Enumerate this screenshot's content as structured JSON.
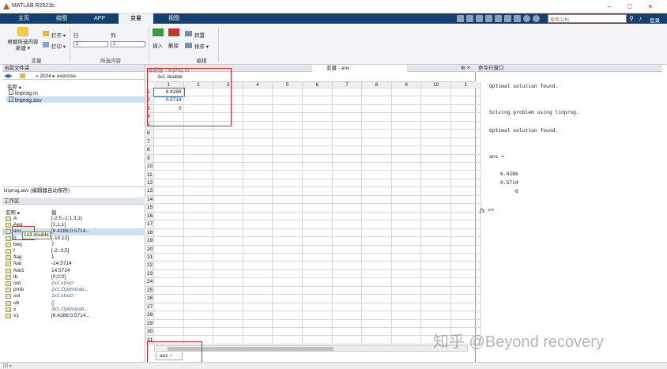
{
  "window": {
    "title": "MATLAB R2021b",
    "controls": [
      "–",
      "□",
      "×"
    ]
  },
  "tabs": [
    {
      "label": "主页"
    },
    {
      "label": "绘图"
    },
    {
      "label": "APP"
    },
    {
      "label": "变量",
      "active": true
    },
    {
      "label": "视图"
    }
  ],
  "search": {
    "placeholder": "搜索文档"
  },
  "login": "登录",
  "ribbon": {
    "new_from_selection": "根据所选内容\n新建 ▾",
    "open": "打开 ▾",
    "print": "打印 ▾",
    "row_label": "行",
    "col_label": "列",
    "row_value": "1",
    "col_value": "1",
    "insert": "插入",
    "delete": "删除",
    "transpose": "转置",
    "sort": "排序 ▾",
    "group_variable": "变量",
    "group_selection": "所选内容",
    "group_edit": "编辑"
  },
  "current_folder": {
    "header": "当前文件夹",
    "path": "« 2024 ▸ exercise",
    "name_col": "名称 ▴",
    "files": [
      {
        "name": "linprog.m"
      },
      {
        "name": "linprog.asv",
        "selected": true
      }
    ],
    "details": "linprog.asv (编辑器自动保存)"
  },
  "workspace": {
    "header": "工作区",
    "col_name": "名称 ▴",
    "col_value": "值",
    "rows": [
      {
        "name": "A",
        "value": "[-2,5,-1;1,3,1]"
      },
      {
        "name": "Aeq",
        "value": "[1,1,1]"
      },
      {
        "name": "ans",
        "value": "[6.4286;0.5714..."
      },
      {
        "name": "b",
        "value": "[-10;12]"
      },
      {
        "name": "beq",
        "value": "7"
      },
      {
        "name": "f",
        "value": "[-2;-3;5]"
      },
      {
        "name": "flag",
        "value": "1"
      },
      {
        "name": "fval",
        "value": "-14.5714"
      },
      {
        "name": "fval1",
        "value": "14.5714"
      },
      {
        "name": "lb",
        "value": "[0;0;0]"
      },
      {
        "name": "out",
        "value": "1x1 struct",
        "italic": true
      },
      {
        "name": "prob",
        "value": "1x1 Optimizati...",
        "italic": true
      },
      {
        "name": "sol",
        "value": "1x1 struct",
        "italic": true
      },
      {
        "name": "ub",
        "value": "[]",
        "italic": true
      },
      {
        "name": "x",
        "value": "3x1 Optimizati...",
        "italic": true
      },
      {
        "name": "x1",
        "value": "[6.4286;0.5714..."
      }
    ],
    "tooltip": "1x3 double"
  },
  "variables": {
    "tab_editor": "编辑器 - linprog.m",
    "tab_vars": "变量 - ans",
    "var_size": "3x1 double",
    "columns": [
      "1",
      "2",
      "3",
      "4",
      "5",
      "6",
      "7",
      "8",
      "9",
      "10",
      "1"
    ],
    "rows": [
      "1",
      "2",
      "3",
      "4",
      "5",
      "6",
      "7",
      "8",
      "9",
      "10",
      "11",
      "12",
      "13",
      "14",
      "15",
      "16",
      "17",
      "18",
      "19",
      "20",
      "21",
      "22",
      "23",
      "24",
      "25",
      "26",
      "27",
      "28",
      "29",
      "30",
      "31"
    ],
    "data": [
      "6.4286",
      "0.5714",
      "0"
    ],
    "bottom_tab": "ans"
  },
  "command_window": {
    "header": "命令行窗口",
    "lines": [
      {
        "text": "Optimal solution found."
      },
      {
        "text": "Solving problem using linprog."
      },
      {
        "text": "Optimal solution found."
      },
      {
        "text": "ans ="
      },
      {
        "text": "6.4286"
      },
      {
        "text": "0.5714"
      },
      {
        "text": "0"
      }
    ],
    "prompt": ">>",
    "fx": "fx"
  },
  "watermark": "知乎 @Beyond recovery",
  "status": "|||| ▴",
  "colors": {
    "tabbar": "#16406b",
    "highlight": "#e0202a"
  }
}
